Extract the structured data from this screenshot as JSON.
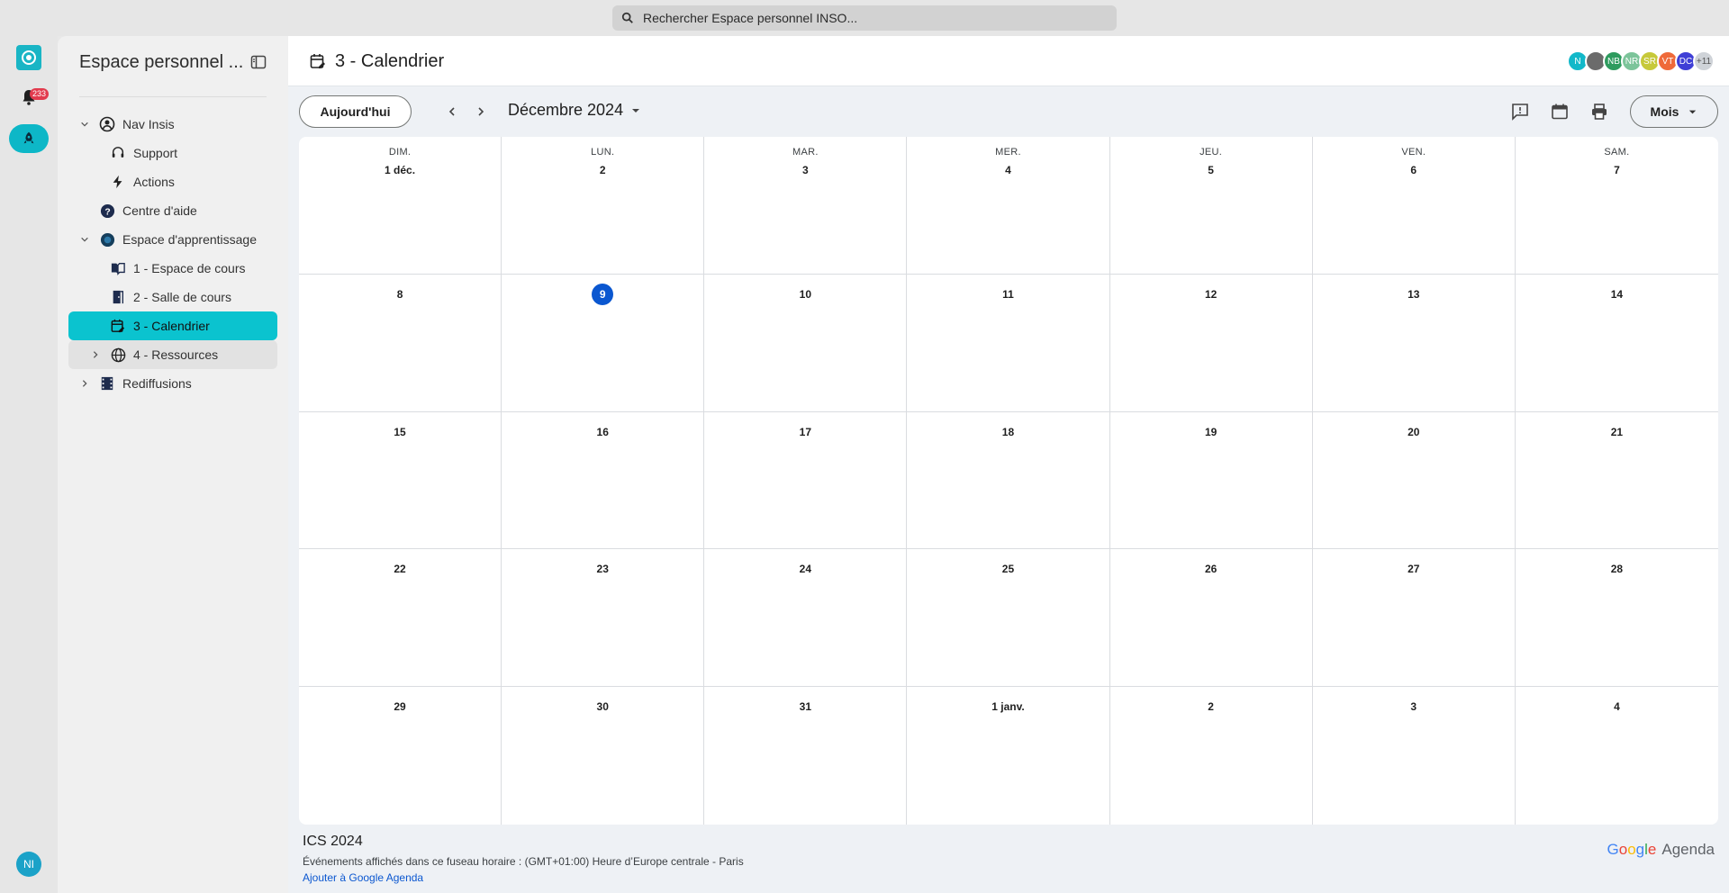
{
  "search": {
    "placeholder": "Rechercher Espace personnel INSO..."
  },
  "rail": {
    "notif_count": "233",
    "user_initials": "NI"
  },
  "sidebar": {
    "title": "Espace personnel ...",
    "items": [
      {
        "label": "Nav Insis"
      },
      {
        "label": "Support"
      },
      {
        "label": "Actions"
      },
      {
        "label": "Centre d'aide"
      },
      {
        "label": "Espace d'apprentissage"
      },
      {
        "label": "1 - Espace de cours"
      },
      {
        "label": "2 - Salle de cours"
      },
      {
        "label": "3 - Calendrier"
      },
      {
        "label": "4 - Ressources"
      },
      {
        "label": "Rediffusions"
      }
    ]
  },
  "header": {
    "title": "3 - Calendrier",
    "avatars": [
      {
        "initials": "N",
        "color": "#12b8c9"
      },
      {
        "initials": "",
        "color": "#6b6b6b"
      },
      {
        "initials": "NB",
        "color": "#2e9b5e"
      },
      {
        "initials": "NR",
        "color": "#7cc49a"
      },
      {
        "initials": "SR",
        "color": "#c7c93a"
      },
      {
        "initials": "VT",
        "color": "#ef6a3a"
      },
      {
        "initials": "DC",
        "color": "#3f3fd6"
      },
      {
        "initials": "+11",
        "color": "#cfd3d8"
      }
    ]
  },
  "toolbar": {
    "today_label": "Aujourd'hui",
    "month_label": "Décembre 2024",
    "view_label": "Mois"
  },
  "calendar": {
    "weekdays": [
      "DIM.",
      "LUN.",
      "MAR.",
      "MER.",
      "JEU.",
      "VEN.",
      "SAM."
    ],
    "days": [
      "1 déc.",
      "2",
      "3",
      "4",
      "5",
      "6",
      "7",
      "8",
      "9",
      "10",
      "11",
      "12",
      "13",
      "14",
      "15",
      "16",
      "17",
      "18",
      "19",
      "20",
      "21",
      "22",
      "23",
      "24",
      "25",
      "26",
      "27",
      "28",
      "29",
      "30",
      "31",
      "1 janv.",
      "2",
      "3",
      "4"
    ],
    "today": "9"
  },
  "footer": {
    "title": "ICS 2024",
    "timezone": "Événements affichés dans ce fuseau horaire : (GMT+01:00) Heure d’Europe centrale - Paris",
    "add_link": "Ajouter à Google Agenda",
    "brand_google": "Google",
    "brand_agenda": "Agenda"
  }
}
